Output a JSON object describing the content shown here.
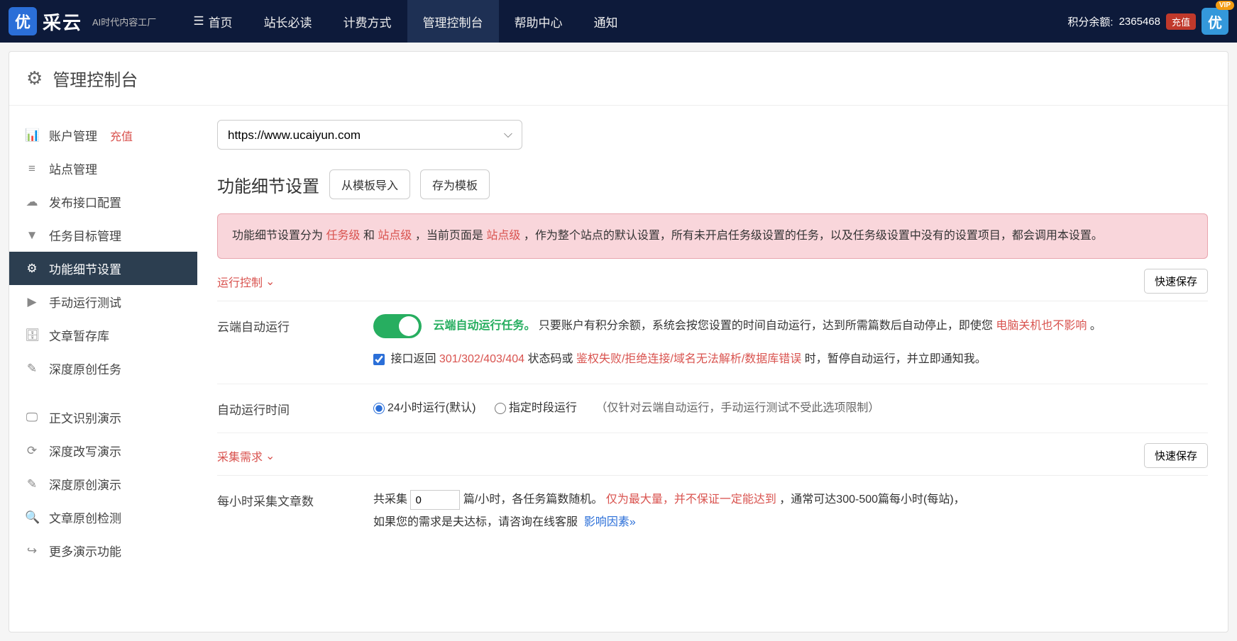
{
  "topnav": {
    "logo_char": "优",
    "logo_text": "采云",
    "logo_sub": "AI时代内容工厂",
    "items": [
      "首页",
      "站长必读",
      "计费方式",
      "管理控制台",
      "帮助中心",
      "通知"
    ],
    "points_label": "积分余额:",
    "points_value": "2365468",
    "recharge": "充值",
    "avatar_char": "优",
    "vip": "VIP"
  },
  "page": {
    "title": "管理控制台"
  },
  "sidebar": {
    "items": [
      {
        "label": "账户管理",
        "badge": "充值"
      },
      {
        "label": "站点管理"
      },
      {
        "label": "发布接口配置"
      },
      {
        "label": "任务目标管理"
      },
      {
        "label": "功能细节设置",
        "active": true
      },
      {
        "label": "手动运行测试"
      },
      {
        "label": "文章暂存库"
      },
      {
        "label": "深度原创任务"
      }
    ],
    "demo_items": [
      {
        "label": "正文识别演示"
      },
      {
        "label": "深度改写演示"
      },
      {
        "label": "深度原创演示"
      },
      {
        "label": "文章原创检测"
      },
      {
        "label": "更多演示功能"
      }
    ]
  },
  "main": {
    "url_select": "https://www.ucaiyun.com",
    "section_title": "功能细节设置",
    "btn_import": "从模板导入",
    "btn_save_tpl": "存为模板",
    "alert": {
      "p1_a": "功能细节设置分为",
      "p1_task": "任务级",
      "p1_b": "和",
      "p1_site": "站点级",
      "p1_c": "，当前页面是",
      "p1_site2": "站点级",
      "p1_d": "，作为整个站点的默认设置，所有未开启任务级设置的任务，以及任务级设置中没有的设置项目，都会调用本设置。"
    },
    "group1": {
      "title": "运行控制",
      "quick_save": "快速保存",
      "row1": {
        "label": "云端自动运行",
        "desc_green": "云端自动运行任务。",
        "desc_a": "只要账户有积分余额，系统会按您设置的时间自动运行，达到所需篇数后自动停止，即使您",
        "desc_red": "电脑关机也不影响",
        "desc_b": "。",
        "cb_a": "接口返回",
        "cb_codes": "301/302/403/404",
        "cb_b": "状态码或",
        "cb_err": "鉴权失败/拒绝连接/域名无法解析/数据库错误",
        "cb_c": "时，暂停自动运行，并立即通知我。"
      },
      "row2": {
        "label": "自动运行时间",
        "opt1": "24小时运行(默认)",
        "opt2": "指定时段运行",
        "hint": "（仅针对云端自动运行，手动运行测试不受此选项限制）"
      }
    },
    "group2": {
      "title": "采集需求",
      "quick_save": "快速保存",
      "row1": {
        "label": "每小时采集文章数",
        "a": "共采集",
        "input": "0",
        "b": "篇/小时，各任务篇数随机。",
        "red": "仅为最大量，并不保证一定能达到",
        "c": "，通常可达300-500篇每小时(每站)，",
        "d": "如果您的需求是夫达标，请咨询在线客服",
        "link": "影响因素»"
      }
    }
  }
}
